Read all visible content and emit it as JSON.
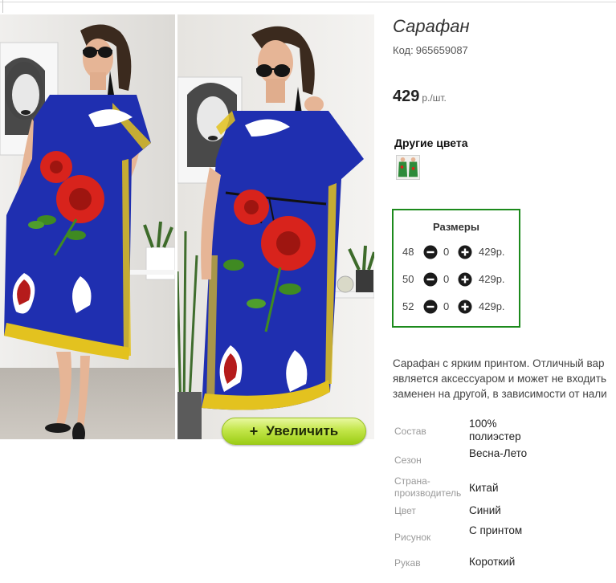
{
  "product": {
    "title": "Сарафан",
    "sku_label": "Код:",
    "sku_value": "965659087",
    "price_value": "429",
    "price_unit": "р./шт."
  },
  "gallery": {
    "zoom_label": "Увеличить",
    "zoom_icon": "plus-icon"
  },
  "other_colors": {
    "title": "Другие цвета",
    "thumb_color": "#2e8b3a"
  },
  "sizes": {
    "title": "Размеры",
    "rows": [
      {
        "size": "48",
        "qty": "0",
        "price": "429р."
      },
      {
        "size": "50",
        "qty": "0",
        "price": "429р."
      },
      {
        "size": "52",
        "qty": "0",
        "price": "429р."
      }
    ]
  },
  "description": {
    "lines": [
      "Сарафан с ярким принтом. Отличный вар",
      "является аксессуаром и может не входить",
      "заменен на другой, в зависимости от нали"
    ]
  },
  "specs": [
    {
      "name": "Состав",
      "value": "100% полиэстер"
    },
    {
      "name": "Сезон",
      "value": "Весна-Лето"
    },
    {
      "name": "Страна-производитель",
      "value": "Китай"
    },
    {
      "name": "Цвет",
      "value": "Синий"
    },
    {
      "name": "Рисунок",
      "value": "С принтом"
    },
    {
      "name": "Рукав",
      "value": "Короткий"
    }
  ],
  "colors": {
    "dress_blue": "#1f2fb0",
    "rose_red": "#d8231c",
    "leaf_green": "#3f8a22",
    "border_yellow": "#e3c21f",
    "sizes_border": "#1c8a1c",
    "zoom_button": "#a6d21c"
  }
}
